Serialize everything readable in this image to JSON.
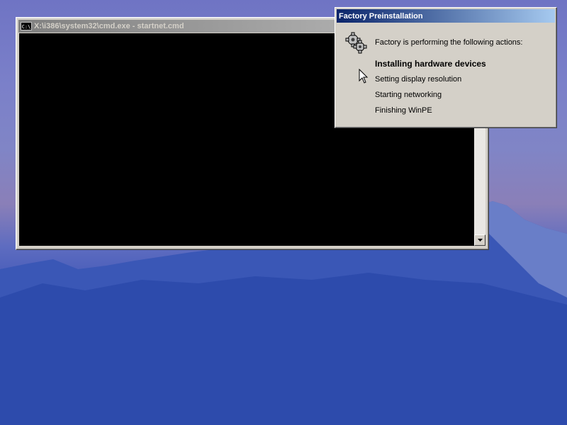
{
  "cmd_window": {
    "title": "X:\\i386\\system32\\cmd.exe - startnet.cmd",
    "icon_label": "C:\\"
  },
  "factory_dialog": {
    "title": "Factory Preinstallation",
    "intro": "Factory is performing the following actions:",
    "actions": [
      {
        "label": "Installing hardware devices",
        "state": "current"
      },
      {
        "label": "Setting display resolution",
        "state": "pending"
      },
      {
        "label": "Starting networking",
        "state": "pending"
      },
      {
        "label": "Finishing WinPE",
        "state": "pending"
      }
    ],
    "icon": "gears-icon"
  },
  "colors": {
    "active_title_start": "#0a246a",
    "active_title_end": "#a6caf0",
    "inactive_title_start": "#808080",
    "window_face": "#d4d0c8",
    "console_bg": "#000000"
  }
}
